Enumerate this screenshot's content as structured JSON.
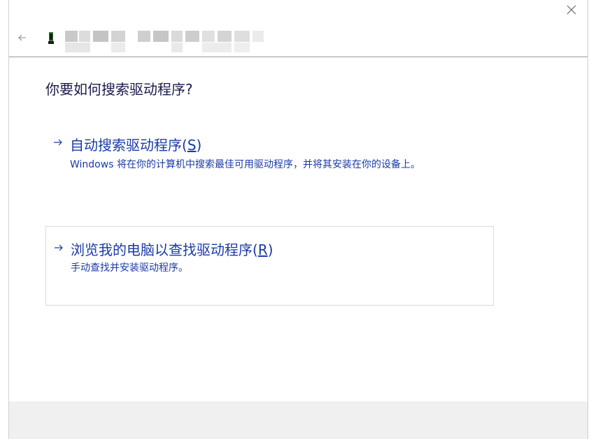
{
  "dialog": {
    "blurred_title": "",
    "close_icon": "close-icon",
    "back_icon": "back-arrow-icon",
    "device_icon": "device-icon"
  },
  "main": {
    "heading": "你要如何搜索驱动程序?",
    "options": [
      {
        "title_prefix": "自动搜索驱动程序(",
        "accel": "S",
        "title_suffix": ")",
        "description": "Windows 将在你的计算机中搜索最佳可用驱动程序，并将其安装在你的设备上。",
        "icon": "arrow-right-icon"
      },
      {
        "title_prefix": "浏览我的电脑以查找驱动程序(",
        "accel": "R",
        "title_suffix": ")",
        "description": "手动查找并安装驱动程序。",
        "icon": "arrow-right-icon"
      }
    ]
  },
  "colors": {
    "link": "#1a3aa6",
    "heading": "#1a1a4a",
    "footer_bg": "#f0f0f0"
  }
}
